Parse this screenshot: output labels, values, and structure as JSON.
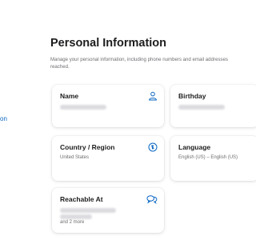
{
  "nav": {
    "partial_link_label": "on"
  },
  "page": {
    "title": "Personal Information",
    "description": "Manage your personal information, including phone numbers and email addresses reached."
  },
  "cards": {
    "name": {
      "title": "Name",
      "icon": "person-icon"
    },
    "birthday": {
      "title": "Birthday"
    },
    "country": {
      "title": "Country / Region",
      "value": "United States",
      "icon": "globe-icon"
    },
    "language": {
      "title": "Language",
      "value": "English (US) – English (US)"
    },
    "reachable": {
      "title": "Reachable At",
      "extra": "and 2 more",
      "icon": "speech-bubbles-icon"
    }
  },
  "colors": {
    "accent": "#0a66c2",
    "text": "#1d1d1f",
    "secondary": "#6e6e73"
  }
}
